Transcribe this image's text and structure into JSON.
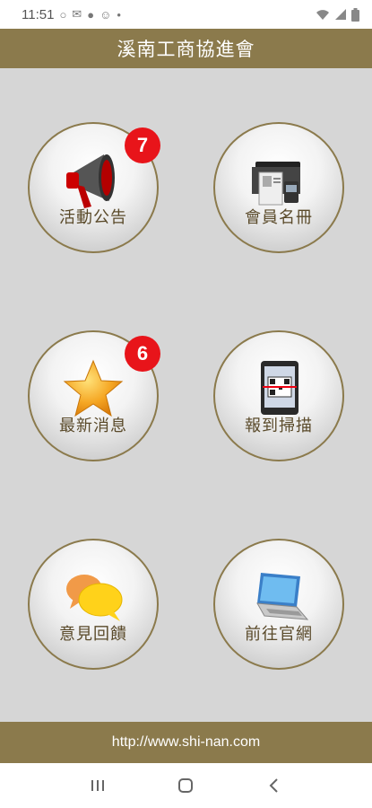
{
  "status": {
    "time": "11:51",
    "icons_left": [
      "circle-outline-icon",
      "mail-icon",
      "circle-filled-icon",
      "smiley-icon",
      "dot-icon"
    ],
    "icons_right": [
      "wifi-icon",
      "signal-icon",
      "battery-icon"
    ]
  },
  "header": {
    "title": "溪南工商協進會"
  },
  "menu": [
    {
      "label": "活動公告",
      "badge": "7",
      "icon": "megaphone-icon"
    },
    {
      "label": "會員名冊",
      "badge": "",
      "icon": "folder-contacts-icon"
    },
    {
      "label": "最新消息",
      "badge": "6",
      "icon": "star-icon"
    },
    {
      "label": "報到掃描",
      "badge": "",
      "icon": "qr-scan-phone-icon"
    },
    {
      "label": "意見回饋",
      "badge": "",
      "icon": "chat-bubbles-icon"
    },
    {
      "label": "前往官網",
      "badge": "",
      "icon": "laptop-icon"
    }
  ],
  "footer": {
    "url": "http://www.shi-nan.com"
  },
  "colors": {
    "brand": "#8b7a4c",
    "badge": "#e8141a",
    "background": "#d6d6d6"
  }
}
